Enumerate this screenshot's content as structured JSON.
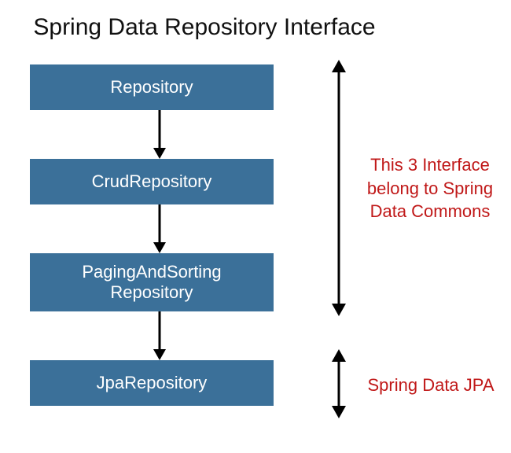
{
  "title": "Spring Data Repository Interface",
  "boxes": {
    "repository": "Repository",
    "crud": "CrudRepository",
    "paging": "PagingAndSorting\nRepository",
    "jpa": "JpaRepository"
  },
  "annotations": {
    "commons": "This 3 Interface belong to Spring Data Commons",
    "jpa": "Spring Data JPA"
  },
  "colors": {
    "box_fill": "#3b7099",
    "box_text": "#ffffff",
    "annotation_text": "#c01818",
    "arrow": "#000000"
  }
}
